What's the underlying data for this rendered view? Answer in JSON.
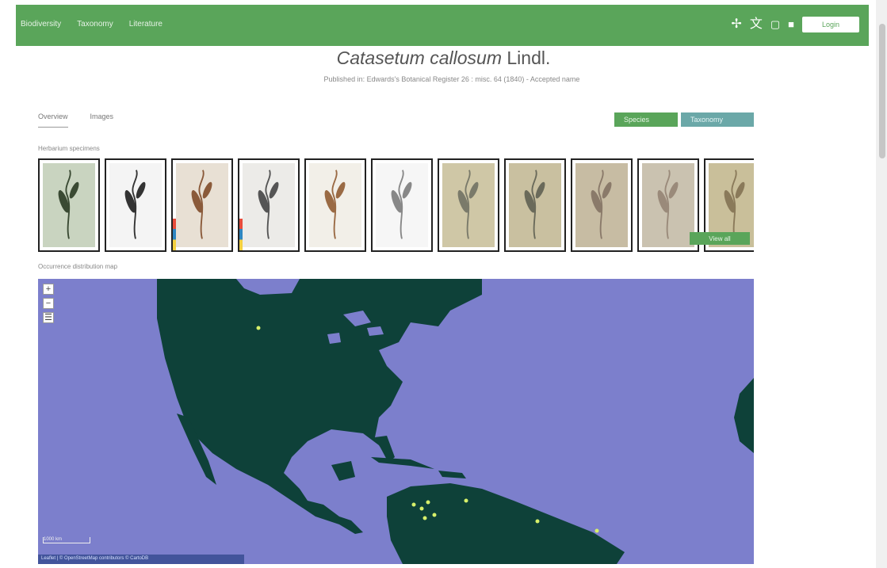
{
  "nav": {
    "links": [
      "Biodiversity",
      "Taxonomy",
      "Literature"
    ],
    "icons": [
      "plant-icon",
      "translate-icon",
      "bookmark-icon",
      "user-icon"
    ],
    "login_label": "Login"
  },
  "page": {
    "title_genus_species": "Catasetum callosum",
    "title_author": "Lindl.",
    "subtitle": "Published in: Edwards's Botanical Register 26 : misc. 64 (1840) - Accepted name"
  },
  "subtabs": [
    "Overview",
    "Images"
  ],
  "buttons": {
    "primary": "Species",
    "secondary": "Taxonomy"
  },
  "thumbs": {
    "heading": "Herbarium specimens",
    "view_all": "View all",
    "colors": [
      "#c9d4c0",
      "#f4f4f4",
      "#e8e0d4",
      "#ecebe8",
      "#f2efe8",
      "#f6f6f6",
      "#cfc7a6",
      "#c9c0a0",
      "#c7bca3",
      "#cac2b0",
      "#c9bf9a"
    ],
    "plant_colors": [
      "#3a4a33",
      "#333",
      "#8a5a3a",
      "#555",
      "#9a6a44",
      "#888",
      "#7a7a6a",
      "#6a6a5a",
      "#8a7a6a",
      "#9a8a7a",
      "#8a7a5a"
    ]
  },
  "map": {
    "heading": "Occurrence distribution map",
    "ocean_color": "#7c7fcc",
    "land_color": "#0e4139",
    "point_color": "#d7f06a",
    "zoom_in": "+",
    "zoom_out": "−",
    "scale_label": "1000 km",
    "attribution": "Leaflet | © OpenStreetMap contributors © CartoDB"
  }
}
